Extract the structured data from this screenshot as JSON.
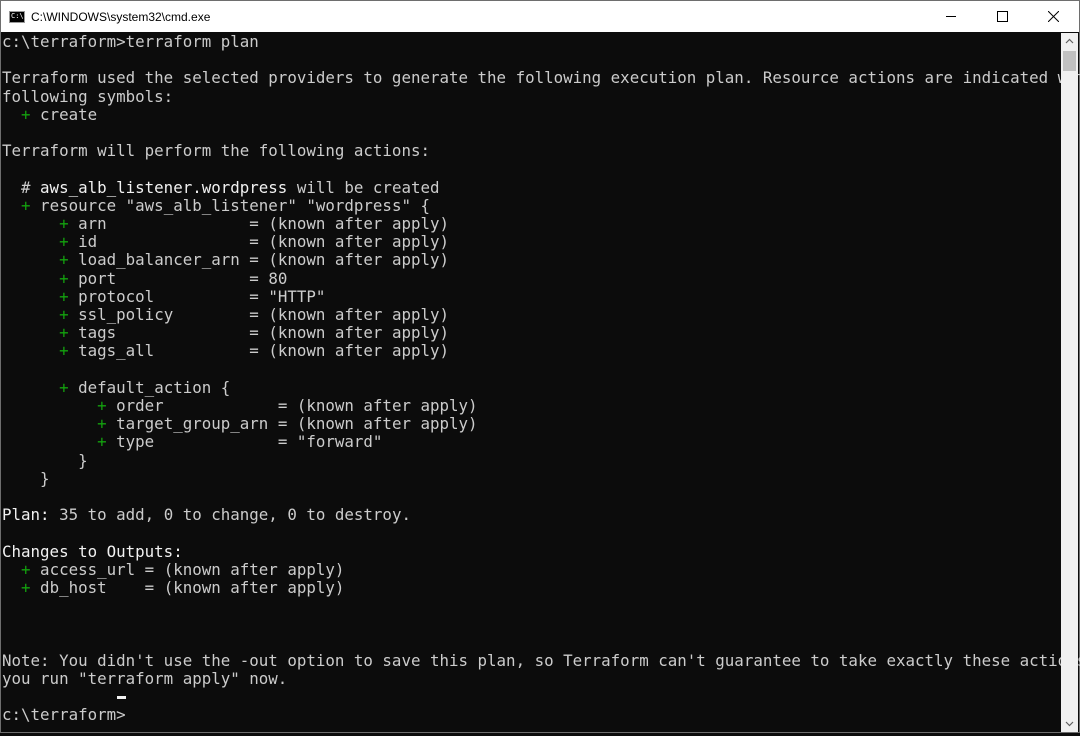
{
  "window": {
    "title": "C:\\WINDOWS\\system32\\cmd.exe",
    "app_icon_text": "C:\\",
    "app_icon": "cmd-icon",
    "controls": [
      "minimize-icon",
      "maximize-icon",
      "close-icon"
    ]
  },
  "console": {
    "lines": [
      {
        "segs": [
          {
            "t": "c:\\terraform>terraform plan",
            "c": "n"
          }
        ]
      },
      {
        "segs": []
      },
      {
        "segs": [
          {
            "t": "Terraform used the selected providers to generate the following execution plan. Resource actions are indicated with the",
            "c": "n"
          }
        ]
      },
      {
        "segs": [
          {
            "t": "following symbols:",
            "c": "n"
          }
        ]
      },
      {
        "segs": [
          {
            "t": "  ",
            "c": "n"
          },
          {
            "t": "+",
            "c": "g"
          },
          {
            "t": " create",
            "c": "n"
          }
        ]
      },
      {
        "segs": []
      },
      {
        "segs": [
          {
            "t": "Terraform will perform the following actions:",
            "c": "n"
          }
        ]
      },
      {
        "segs": []
      },
      {
        "segs": [
          {
            "t": "  # ",
            "c": "n"
          },
          {
            "t": "aws_alb_listener.wordpress",
            "c": "b"
          },
          {
            "t": " will be created",
            "c": "n"
          }
        ]
      },
      {
        "segs": [
          {
            "t": "  ",
            "c": "n"
          },
          {
            "t": "+",
            "c": "g"
          },
          {
            "t": " resource \"aws_alb_listener\" \"wordpress\" {",
            "c": "n"
          }
        ]
      },
      {
        "segs": [
          {
            "t": "      ",
            "c": "n"
          },
          {
            "t": "+",
            "c": "g"
          },
          {
            "t": " arn               = (known after apply)",
            "c": "n"
          }
        ]
      },
      {
        "segs": [
          {
            "t": "      ",
            "c": "n"
          },
          {
            "t": "+",
            "c": "g"
          },
          {
            "t": " id                = (known after apply)",
            "c": "n"
          }
        ]
      },
      {
        "segs": [
          {
            "t": "      ",
            "c": "n"
          },
          {
            "t": "+",
            "c": "g"
          },
          {
            "t": " load_balancer_arn = (known after apply)",
            "c": "n"
          }
        ]
      },
      {
        "segs": [
          {
            "t": "      ",
            "c": "n"
          },
          {
            "t": "+",
            "c": "g"
          },
          {
            "t": " port              = 80",
            "c": "n"
          }
        ]
      },
      {
        "segs": [
          {
            "t": "      ",
            "c": "n"
          },
          {
            "t": "+",
            "c": "g"
          },
          {
            "t": " protocol          = \"HTTP\"",
            "c": "n"
          }
        ]
      },
      {
        "segs": [
          {
            "t": "      ",
            "c": "n"
          },
          {
            "t": "+",
            "c": "g"
          },
          {
            "t": " ssl_policy        = (known after apply)",
            "c": "n"
          }
        ]
      },
      {
        "segs": [
          {
            "t": "      ",
            "c": "n"
          },
          {
            "t": "+",
            "c": "g"
          },
          {
            "t": " tags              = (known after apply)",
            "c": "n"
          }
        ]
      },
      {
        "segs": [
          {
            "t": "      ",
            "c": "n"
          },
          {
            "t": "+",
            "c": "g"
          },
          {
            "t": " tags_all          = (known after apply)",
            "c": "n"
          }
        ]
      },
      {
        "segs": []
      },
      {
        "segs": [
          {
            "t": "      ",
            "c": "n"
          },
          {
            "t": "+",
            "c": "g"
          },
          {
            "t": " default_action {",
            "c": "n"
          }
        ]
      },
      {
        "segs": [
          {
            "t": "          ",
            "c": "n"
          },
          {
            "t": "+",
            "c": "g"
          },
          {
            "t": " order            = (known after apply)",
            "c": "n"
          }
        ]
      },
      {
        "segs": [
          {
            "t": "          ",
            "c": "n"
          },
          {
            "t": "+",
            "c": "g"
          },
          {
            "t": " target_group_arn = (known after apply)",
            "c": "n"
          }
        ]
      },
      {
        "segs": [
          {
            "t": "          ",
            "c": "n"
          },
          {
            "t": "+",
            "c": "g"
          },
          {
            "t": " type             = \"forward\"",
            "c": "n"
          }
        ]
      },
      {
        "segs": [
          {
            "t": "        }",
            "c": "n"
          }
        ]
      },
      {
        "segs": [
          {
            "t": "    }",
            "c": "n"
          }
        ]
      },
      {
        "segs": []
      },
      {
        "segs": [
          {
            "t": "Plan:",
            "c": "b"
          },
          {
            "t": " 35 to add, 0 to change, 0 to destroy.",
            "c": "n"
          }
        ]
      },
      {
        "segs": []
      },
      {
        "segs": [
          {
            "t": "Changes to Outputs:",
            "c": "b"
          }
        ]
      },
      {
        "segs": [
          {
            "t": "  ",
            "c": "n"
          },
          {
            "t": "+",
            "c": "g"
          },
          {
            "t": " access_url = (known after apply)",
            "c": "n"
          }
        ]
      },
      {
        "segs": [
          {
            "t": "  ",
            "c": "n"
          },
          {
            "t": "+",
            "c": "g"
          },
          {
            "t": " db_host    = (known after apply)",
            "c": "n"
          }
        ]
      },
      {
        "segs": []
      },
      {
        "segs": []
      },
      {
        "segs": []
      },
      {
        "segs": [
          {
            "t": "Note: You didn't use the -out option to save this plan, so Terraform can't guarantee to take exactly these actions if",
            "c": "n"
          }
        ]
      },
      {
        "segs": [
          {
            "t": "you run \"terraform apply\" now.",
            "c": "n"
          }
        ]
      },
      {
        "segs": []
      },
      {
        "segs": [
          {
            "t": "c:\\terraform>",
            "c": "n"
          }
        ]
      }
    ]
  },
  "colors": {
    "text": "#cccccc",
    "bright": "#f2f2f2",
    "plus": "#13a10e",
    "background": "#0c0c0c"
  }
}
